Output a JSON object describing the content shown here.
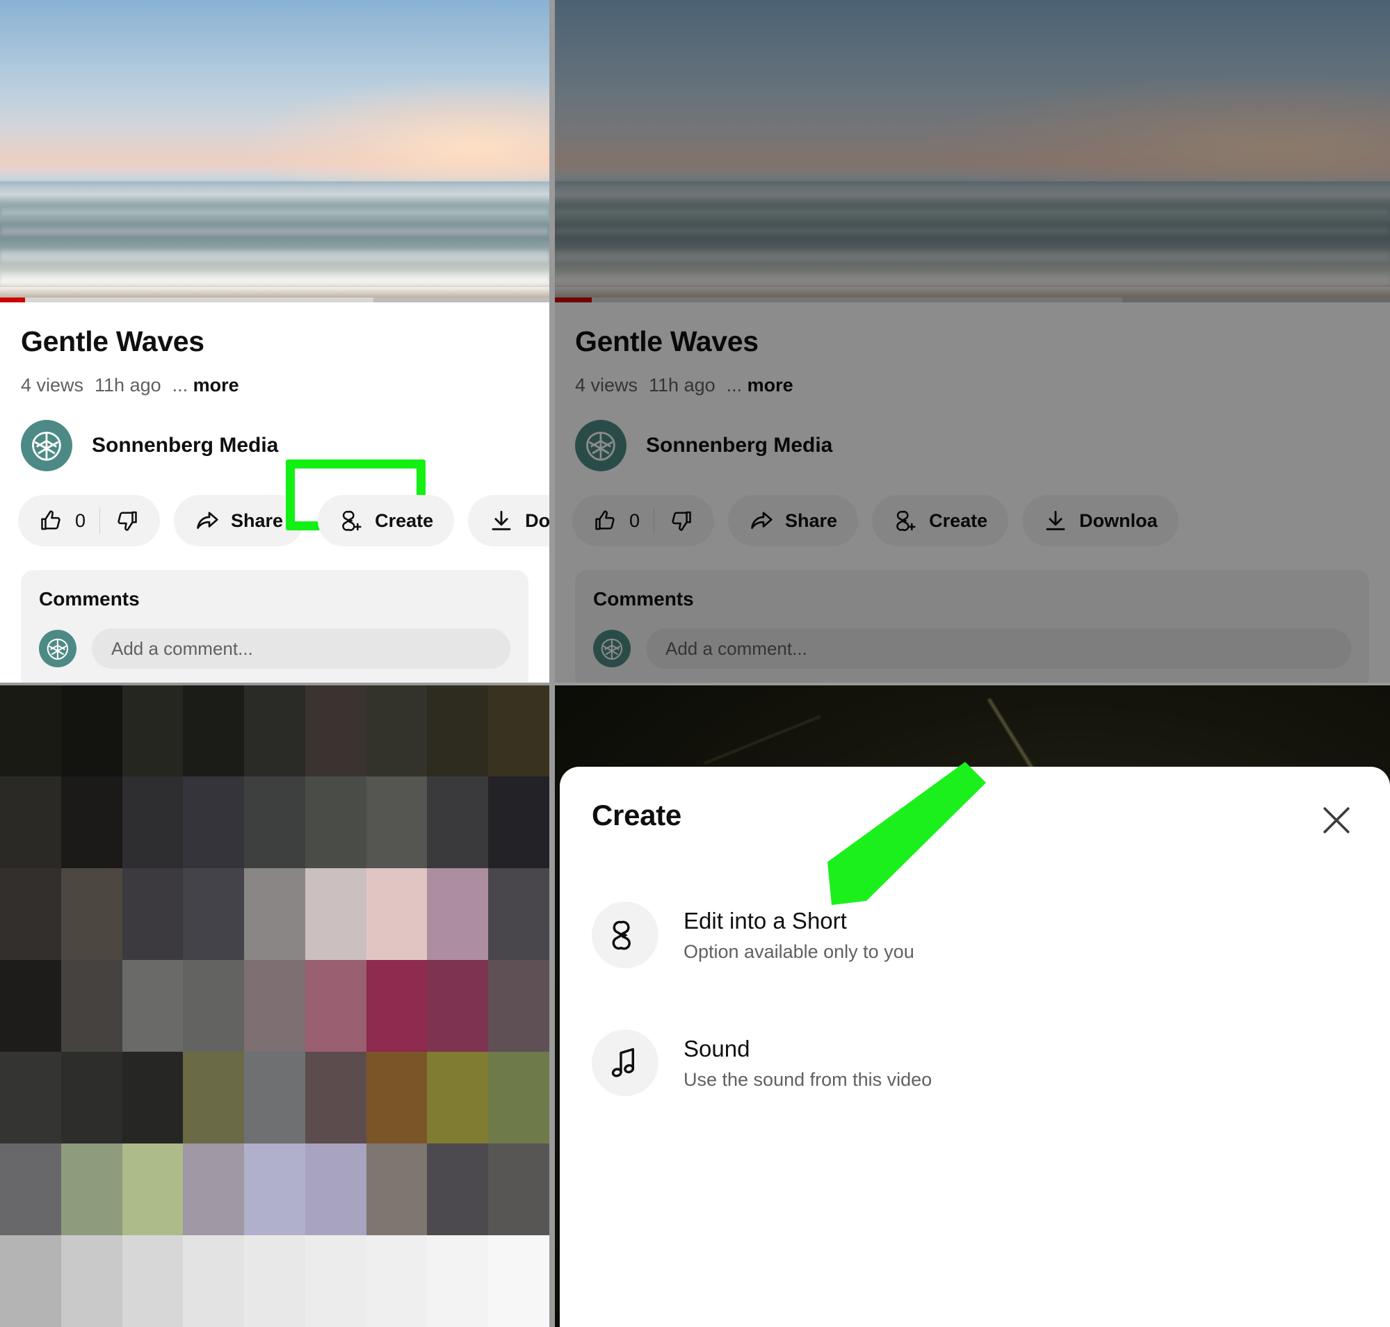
{
  "video": {
    "title": "Gentle Waves",
    "views": "4 views",
    "age": "11h ago",
    "more_dots": "...",
    "more_label": "more",
    "channel_name": "Sonnenberg Media",
    "avatar_icon": "leaf-logo-icon"
  },
  "actions": {
    "like_count": "0",
    "like_icon": "thumbs-up-icon",
    "dislike_icon": "thumbs-down-icon",
    "share_label": "Share",
    "share_icon": "share-arrow-icon",
    "create_label": "Create",
    "create_icon": "create-short-icon",
    "download_label": "Download",
    "download_label_clipped": "Downloa",
    "download_icon": "download-icon"
  },
  "comments": {
    "heading": "Comments",
    "input_placeholder": "Add a comment...",
    "avatar_icon": "leaf-logo-icon"
  },
  "create_sheet": {
    "title": "Create",
    "close_icon": "close-icon",
    "items": [
      {
        "label": "Edit into a Short",
        "sub": "Option available only to you",
        "icon": "shorts-icon"
      },
      {
        "label": "Sound",
        "sub": "Use the sound from this video",
        "icon": "music-note-icon"
      }
    ]
  },
  "annotations": {
    "highlight_color": "#13f013",
    "arrow_color": "#1cf01c",
    "highlight_target": "create-button",
    "arrow_target": "edit-into-a-short-item"
  },
  "colors": {
    "brand_red": "#cc0000",
    "avatar_teal": "#4d8a86",
    "chip_grey": "#f2f2f2",
    "text_primary": "#0f0f0f",
    "text_secondary": "#606060",
    "dim_overlay": "rgba(0,0,0,0.45)"
  },
  "mosaic": {
    "rows": 7,
    "cols": 9,
    "cells": [
      "#1a1a14",
      "#131310",
      "#262620",
      "#1b1b18",
      "#2a2a26",
      "#3a332f",
      "#33332c",
      "#2e2c1f",
      "#3a3220",
      "#2b2926",
      "#1c1a18",
      "#2e2e30",
      "#34343a",
      "#3e4040",
      "#4a4c48",
      "#555552",
      "#3a3a3c",
      "#232226",
      "#332f2c",
      "#4c4740",
      "#3c3a3e",
      "#44434a",
      "#8a8686",
      "#cbbfc0",
      "#e0c6c2",
      "#ad8ea0",
      "#4a474c",
      "#1e1c1a",
      "#454240",
      "#6a6a68",
      "#636361",
      "#7d6f72",
      "#9a5f70",
      "#8e2b4e",
      "#7e3350",
      "#5e5055",
      "#343432",
      "#2d2d2b",
      "#262624",
      "#6b6a46",
      "#6e7072",
      "#5c4c4e",
      "#7a5528",
      "#807c32",
      "#6e7a4a",
      "#68686a",
      "#8e9b7d",
      "#adbb8a",
      "#a098a4",
      "#b0b0cc",
      "#a8a4c0",
      "#7e7670",
      "#4c4a4e",
      "#585654",
      "#b4b4b4",
      "#c9c9c9",
      "#d7d7d7",
      "#e3e3e3",
      "#e8e8e8",
      "#ececec",
      "#efefef",
      "#f3f3f3",
      "#f7f7f7"
    ]
  }
}
